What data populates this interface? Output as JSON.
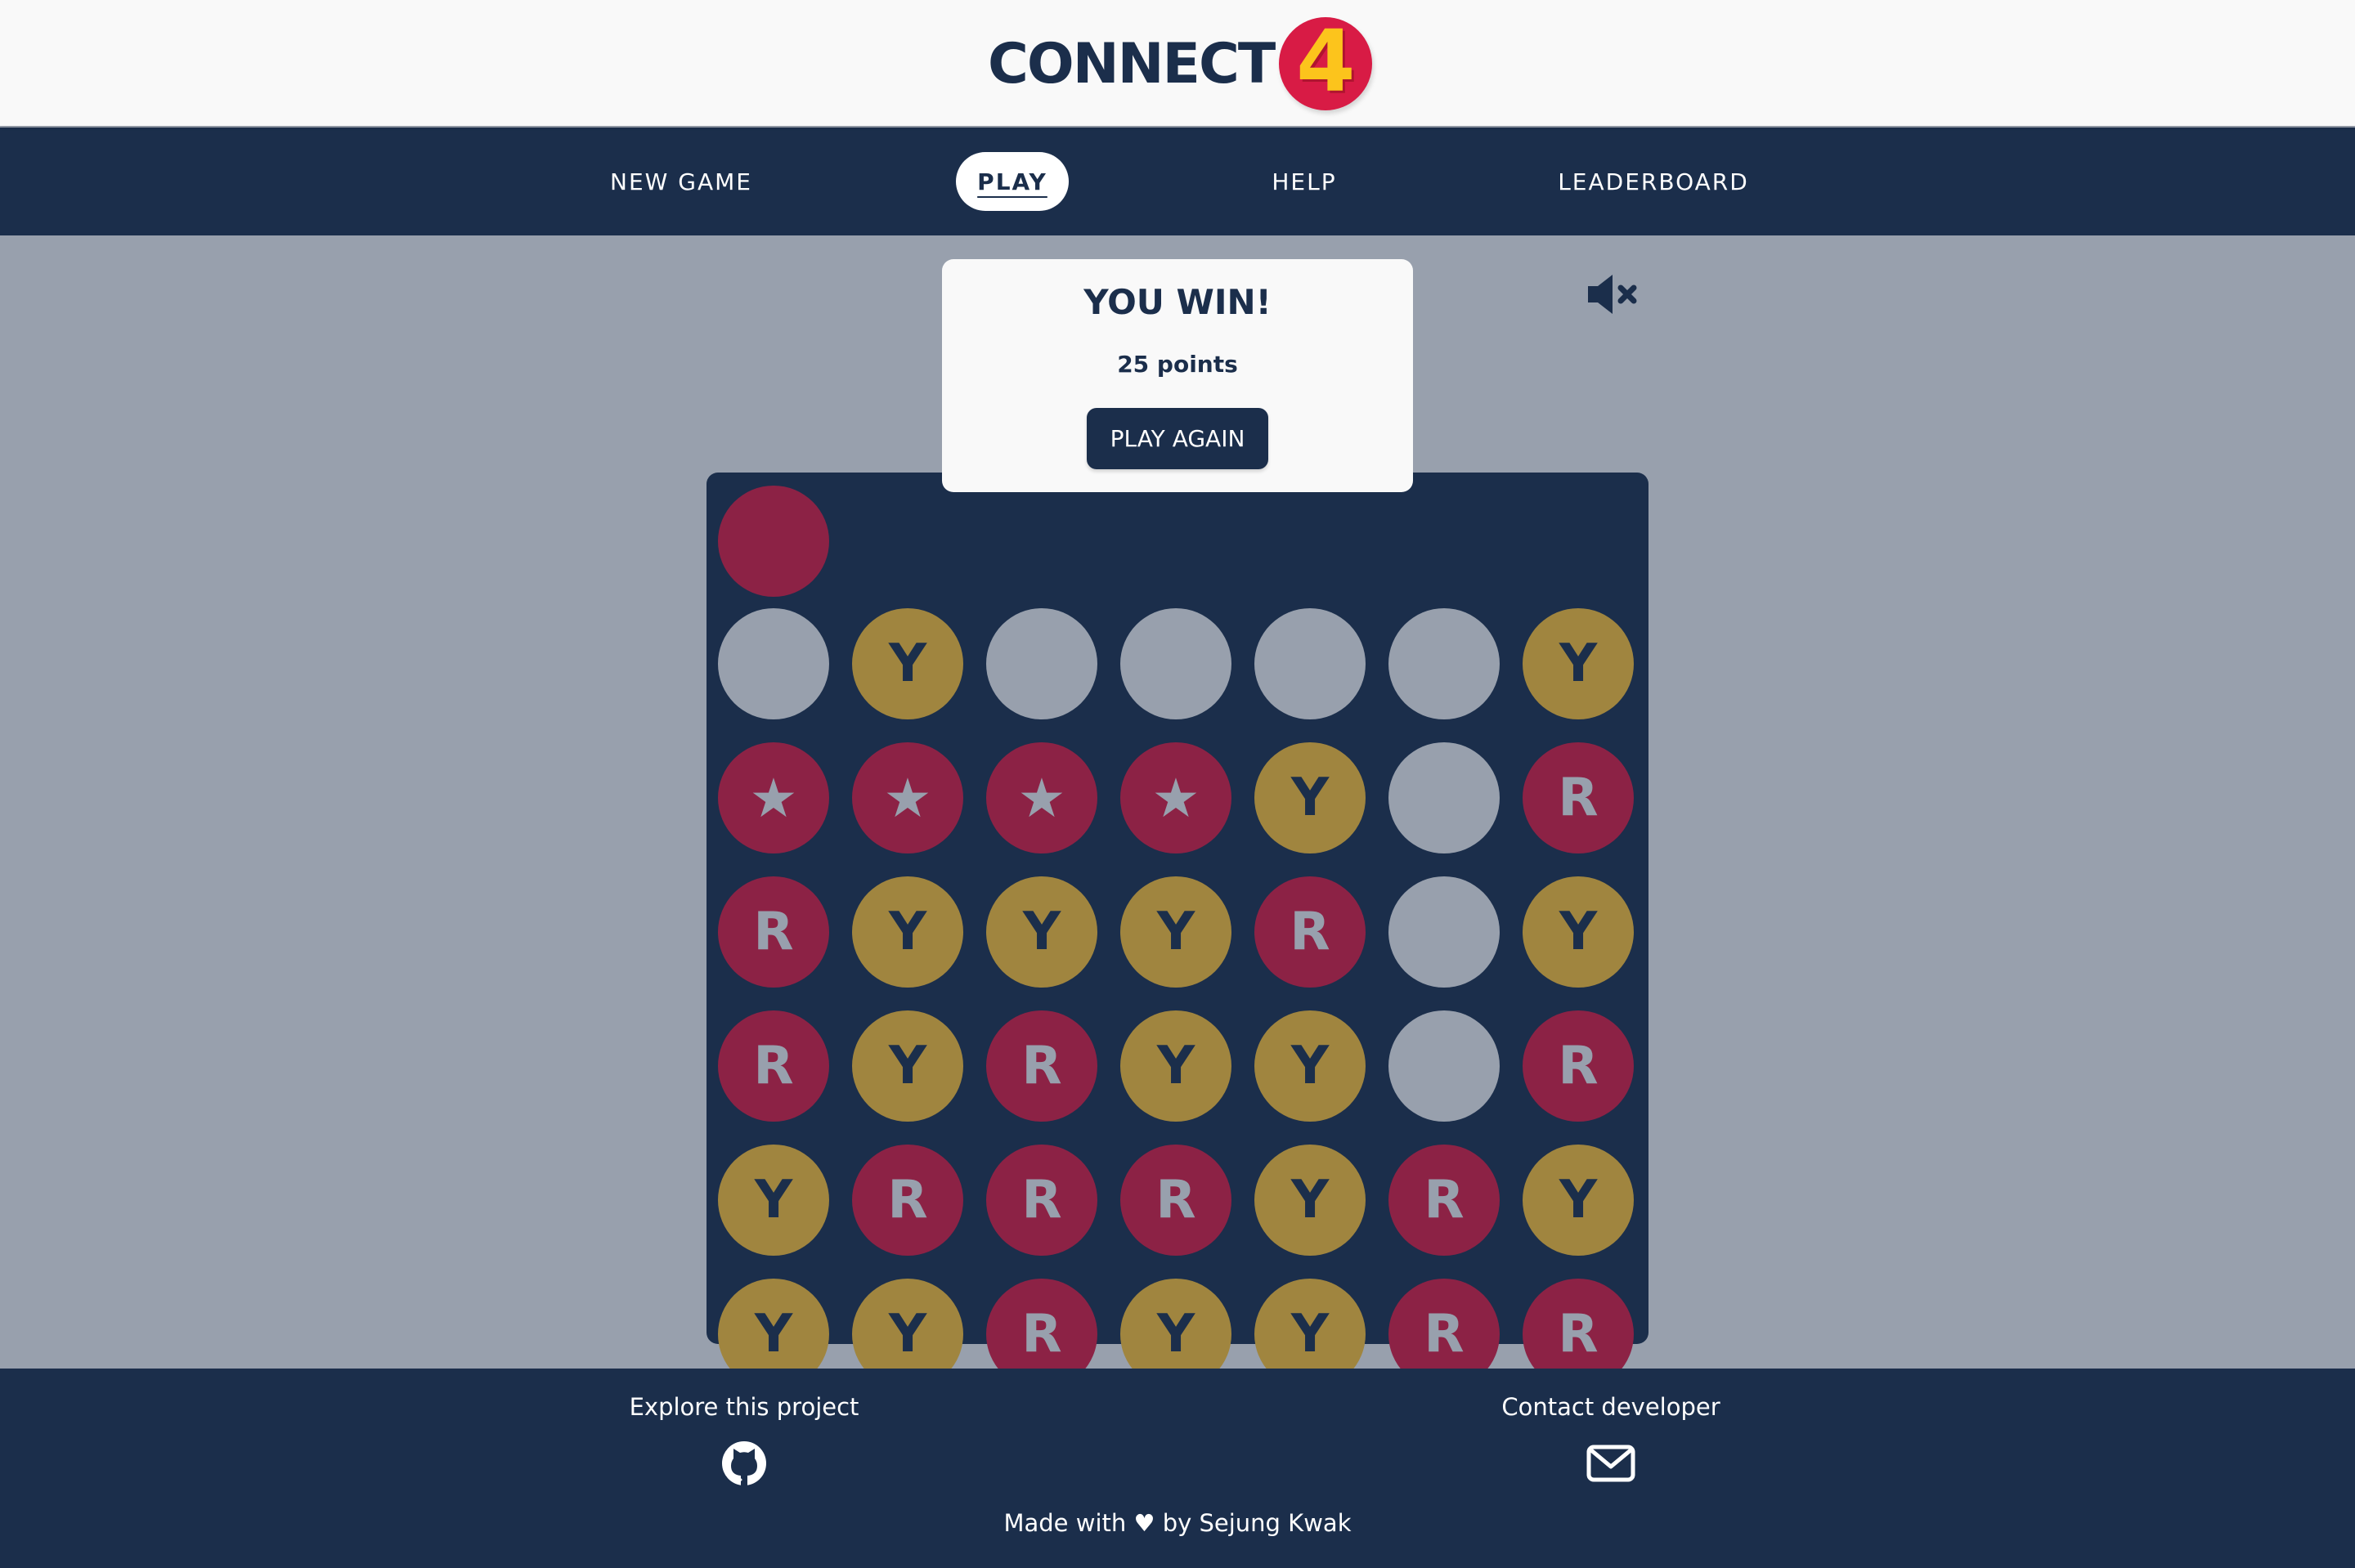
{
  "header": {
    "logo_text": "CONNECT",
    "logo_badge": "4"
  },
  "nav": {
    "items": [
      {
        "label": "NEW GAME",
        "active": false
      },
      {
        "label": "PLAY",
        "active": true
      },
      {
        "label": "HELP",
        "active": false
      },
      {
        "label": "LEADERBOARD",
        "active": false
      }
    ]
  },
  "result": {
    "title": "YOU WIN!",
    "points": "25 points",
    "button_label": "PLAY AGAIN"
  },
  "sound": {
    "muted": true,
    "icon": "volume-mute-icon"
  },
  "game": {
    "preview_color": "red",
    "rows": [
      [
        "E",
        "Y",
        "E",
        "E",
        "E",
        "E",
        "Y"
      ],
      [
        "W",
        "W",
        "W",
        "W",
        "Y",
        "E",
        "R"
      ],
      [
        "R",
        "Y",
        "Y",
        "Y",
        "R",
        "E",
        "Y"
      ],
      [
        "R",
        "Y",
        "R",
        "Y",
        "Y",
        "E",
        "R"
      ],
      [
        "Y",
        "R",
        "R",
        "R",
        "Y",
        "R",
        "Y"
      ],
      [
        "Y",
        "Y",
        "R",
        "Y",
        "Y",
        "R",
        "R"
      ]
    ],
    "marks": {
      "R": "R",
      "Y": "Y",
      "W": "★"
    },
    "colors": {
      "red": "#8c2245",
      "yellow": "#a0853f",
      "empty": "#98a0ad",
      "board": "#1b2e4b"
    }
  },
  "footer": {
    "explore_label": "Explore this project",
    "explore_icon": "github-icon",
    "contact_label": "Contact developer",
    "contact_icon": "mail-icon",
    "made_with": "Made with ♥ by Sejung Kwak"
  },
  "theme": {
    "navy": "#1b2e4b",
    "background": "#98a0ad",
    "brand_red": "#d81b45",
    "brand_yellow": "#fcc41c"
  }
}
